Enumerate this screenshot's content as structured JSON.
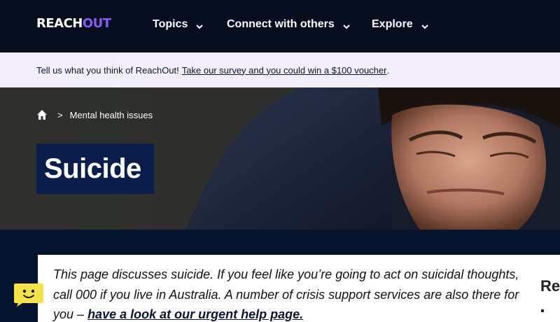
{
  "nav": {
    "logo": {
      "part1": "REACH",
      "part2": "OUT"
    },
    "items": [
      {
        "label": "Topics",
        "icon": "chevron-down-icon"
      },
      {
        "label": "Connect with others",
        "icon": "chevron-down-icon"
      },
      {
        "label": "Explore",
        "icon": "chevron-down-icon"
      }
    ]
  },
  "banner": {
    "text": "Tell us what you think of ReachOut!",
    "link": "Take our survey and you could win a $100 voucher",
    "suffix": "."
  },
  "hero": {
    "breadcrumb": {
      "home_icon": "home-icon",
      "separator": ">",
      "item": "Mental health issues"
    },
    "title": "Suicide"
  },
  "notice": {
    "text": "This page discusses suicide. If you feel like you’re going to act on suicidal thoughts, call 000 if you live in Australia. A number of crisis support services are also there for you –",
    "link": "have a look at our urgent help page."
  },
  "sidebar": {
    "heading_partial": "Re",
    "bullet": "▪"
  },
  "chat_widget": {
    "icon": "smiley-chat-icon"
  },
  "colors": {
    "nav_bg": "#060d1f",
    "banner_bg": "#f3eefb",
    "brand_purple": "#8a5cf5",
    "title_box": "#0b1d4a",
    "content_bg": "#06142e",
    "chat_yellow": "#f6e24a"
  }
}
